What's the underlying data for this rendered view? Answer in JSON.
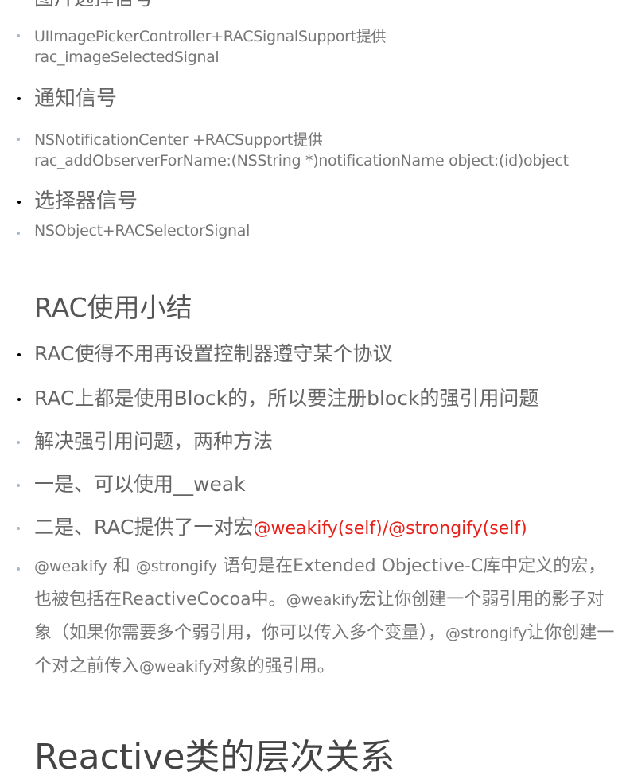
{
  "top_cut_heading": "图片选择信号",
  "items": {
    "image_picker": {
      "line1": "UIImagePickerController+RACSignalSupport提供",
      "line2": "rac_imageSelectedSignal"
    },
    "notification_heading": "通知信号",
    "notification": {
      "line1": "NSNotificationCenter +RACSupport提供",
      "line2": "rac_addObserverForName:(NSString *)notificationName object:(id)object"
    },
    "selector_heading": "选择器信号",
    "selector_item": "NSObject+RACSelectorSignal"
  },
  "summary": {
    "title": "RAC使用小结",
    "points": [
      "RAC使得不用再设置控制器遵守某个协议",
      "RAC上都是使用Block的，所以要注册block的强引用问题",
      "解决强引用问题，两种方法",
      "一是、可以使用__weak"
    ],
    "point5_prefix": "二是、RAC提供了一对宏",
    "point5_macro": "@weakify(self)/@strongify(self)",
    "paragraph": {
      "p1": "@weakify",
      "p2": " 和 ",
      "p3": "@strongify",
      "p4": " 语句是在Extended Objective-C库中定义的宏，也被包括在ReactiveCocoa中。",
      "p5": "@weakify",
      "p6": "宏让你创建一个弱引用的影子对象（如果你需要多个弱引用，你可以传入多个变量），",
      "p7": "@strongify",
      "p8": "让你创建一个对之前传入",
      "p9": "@weakify",
      "p10": "对象的强引用。"
    }
  },
  "bottom_heading": "Reactive类的层次关系",
  "colors": {
    "text": "#666666",
    "macro_red": "#e8201a",
    "bullet_grey": "#a9b8c6"
  }
}
